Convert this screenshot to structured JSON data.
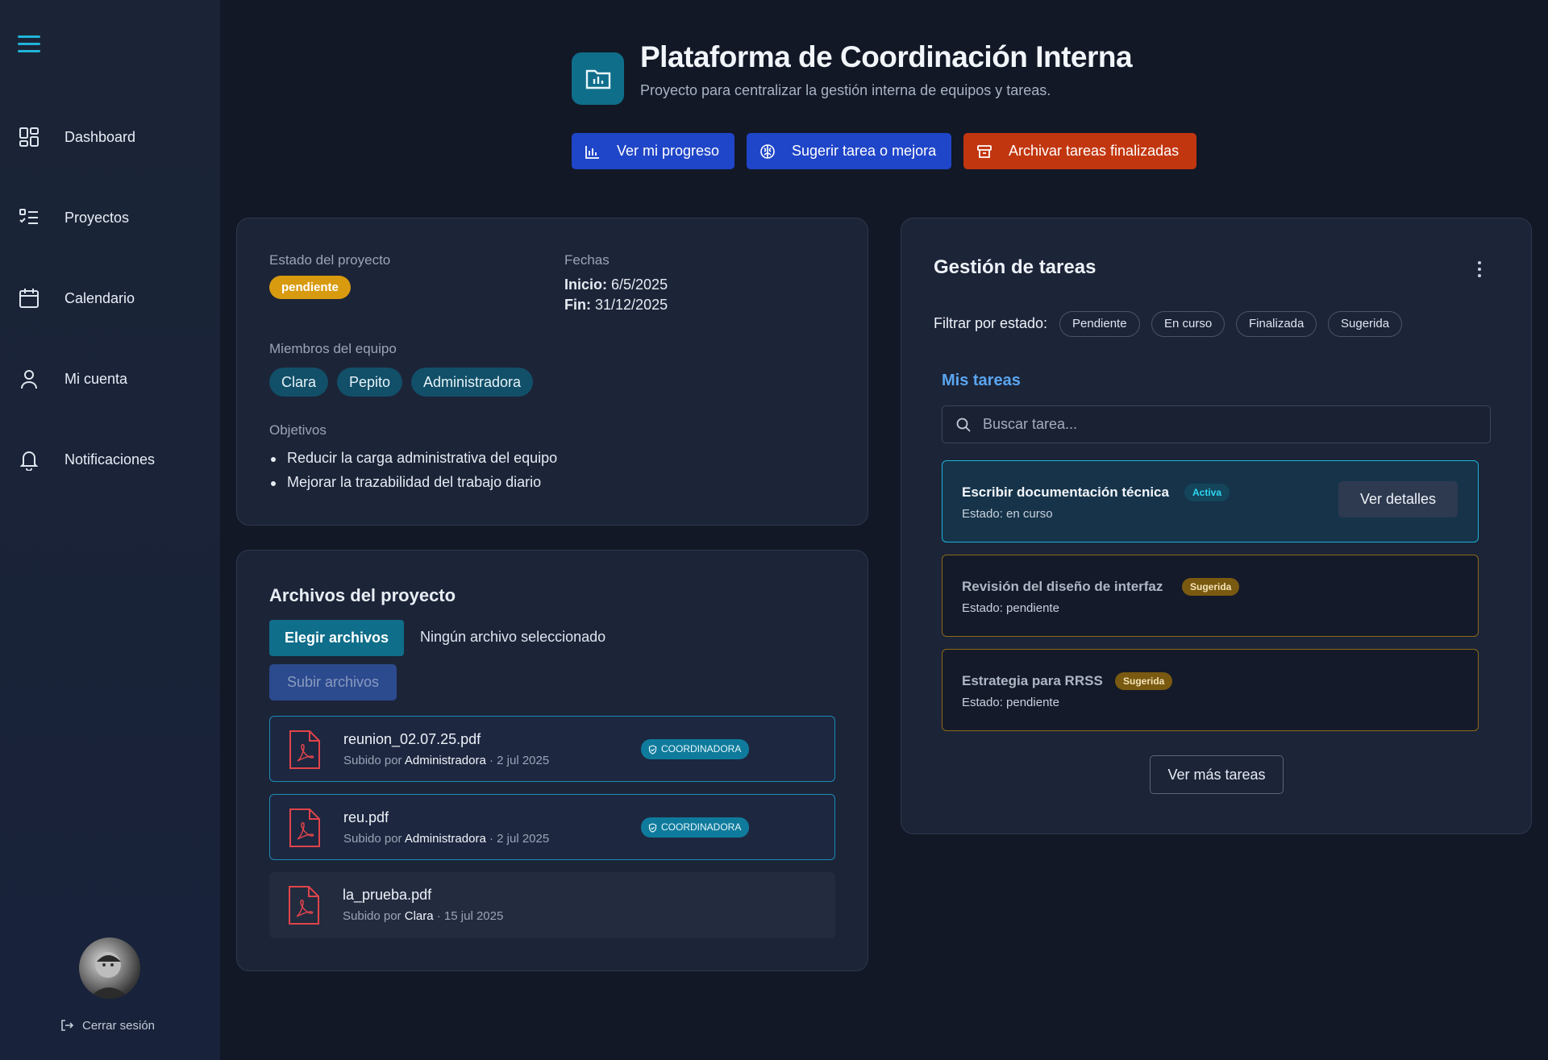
{
  "sidebar": {
    "items": [
      {
        "label": "Dashboard",
        "icon": "dashboard-icon"
      },
      {
        "label": "Proyectos",
        "icon": "list-check-icon"
      },
      {
        "label": "Calendario",
        "icon": "calendar-icon"
      },
      {
        "label": "Mi cuenta",
        "icon": "user-icon"
      },
      {
        "label": "Notificaciones",
        "icon": "bell-icon"
      }
    ],
    "logout_label": "Cerrar sesión"
  },
  "header": {
    "title": "Plataforma de Coordinación Interna",
    "subtitle": "Proyecto para centralizar la gestión interna de equipos y tareas.",
    "buttons": {
      "progress": "Ver mi progreso",
      "suggest": "Sugerir tarea o mejora",
      "archive": "Archivar tareas finalizadas"
    }
  },
  "project": {
    "status_label": "Estado del proyecto",
    "status_value": "pendiente",
    "dates_label": "Fechas",
    "start_label": "Inicio:",
    "start_value": "6/5/2025",
    "end_label": "Fin:",
    "end_value": "31/12/2025",
    "members_label": "Miembros del equipo",
    "members": [
      "Clara",
      "Pepito",
      "Administradora"
    ],
    "objectives_label": "Objetivos",
    "objectives": [
      "Reducir la carga administrativa del equipo",
      "Mejorar la trazabilidad del trabajo diario"
    ]
  },
  "files": {
    "title": "Archivos del proyecto",
    "choose_label": "Elegir archivos",
    "no_file_label": "Ningún archivo seleccionado",
    "upload_label": "Subir archivos",
    "uploaded_by_prefix": "Subido por",
    "list": [
      {
        "name": "reunion_02.07.25.pdf",
        "uploader": "Administradora",
        "date": "· 2 jul 2025",
        "badge": "COORDINADORA"
      },
      {
        "name": "reu.pdf",
        "uploader": "Administradora",
        "date": "· 2 jul 2025",
        "badge": "COORDINADORA"
      },
      {
        "name": "la_prueba.pdf",
        "uploader": "Clara",
        "date": "· 15 jul 2025",
        "badge": ""
      }
    ]
  },
  "tasks": {
    "title": "Gestión de tareas",
    "filter_label": "Filtrar por estado:",
    "filters": [
      "Pendiente",
      "En curso",
      "Finalizada",
      "Sugerida"
    ],
    "my_tasks_label": "Mis tareas",
    "search_placeholder": "Buscar tarea...",
    "items": [
      {
        "name": "Escribir documentación técnica",
        "badge": "Activa",
        "status": "Estado: en curso",
        "action": "Ver detalles"
      },
      {
        "name": "Revisión del diseño de interfaz",
        "badge": "Sugerida",
        "status": "Estado: pendiente"
      },
      {
        "name": "Estrategia para RRSS",
        "badge": "Sugerida",
        "status": "Estado: pendiente"
      }
    ],
    "more_label": "Ver más tareas"
  },
  "colors": {
    "accent": "#1fb4d8",
    "primary_button": "#1f45c8",
    "danger_button": "#c2360f",
    "pending_badge": "#d89a0f"
  }
}
